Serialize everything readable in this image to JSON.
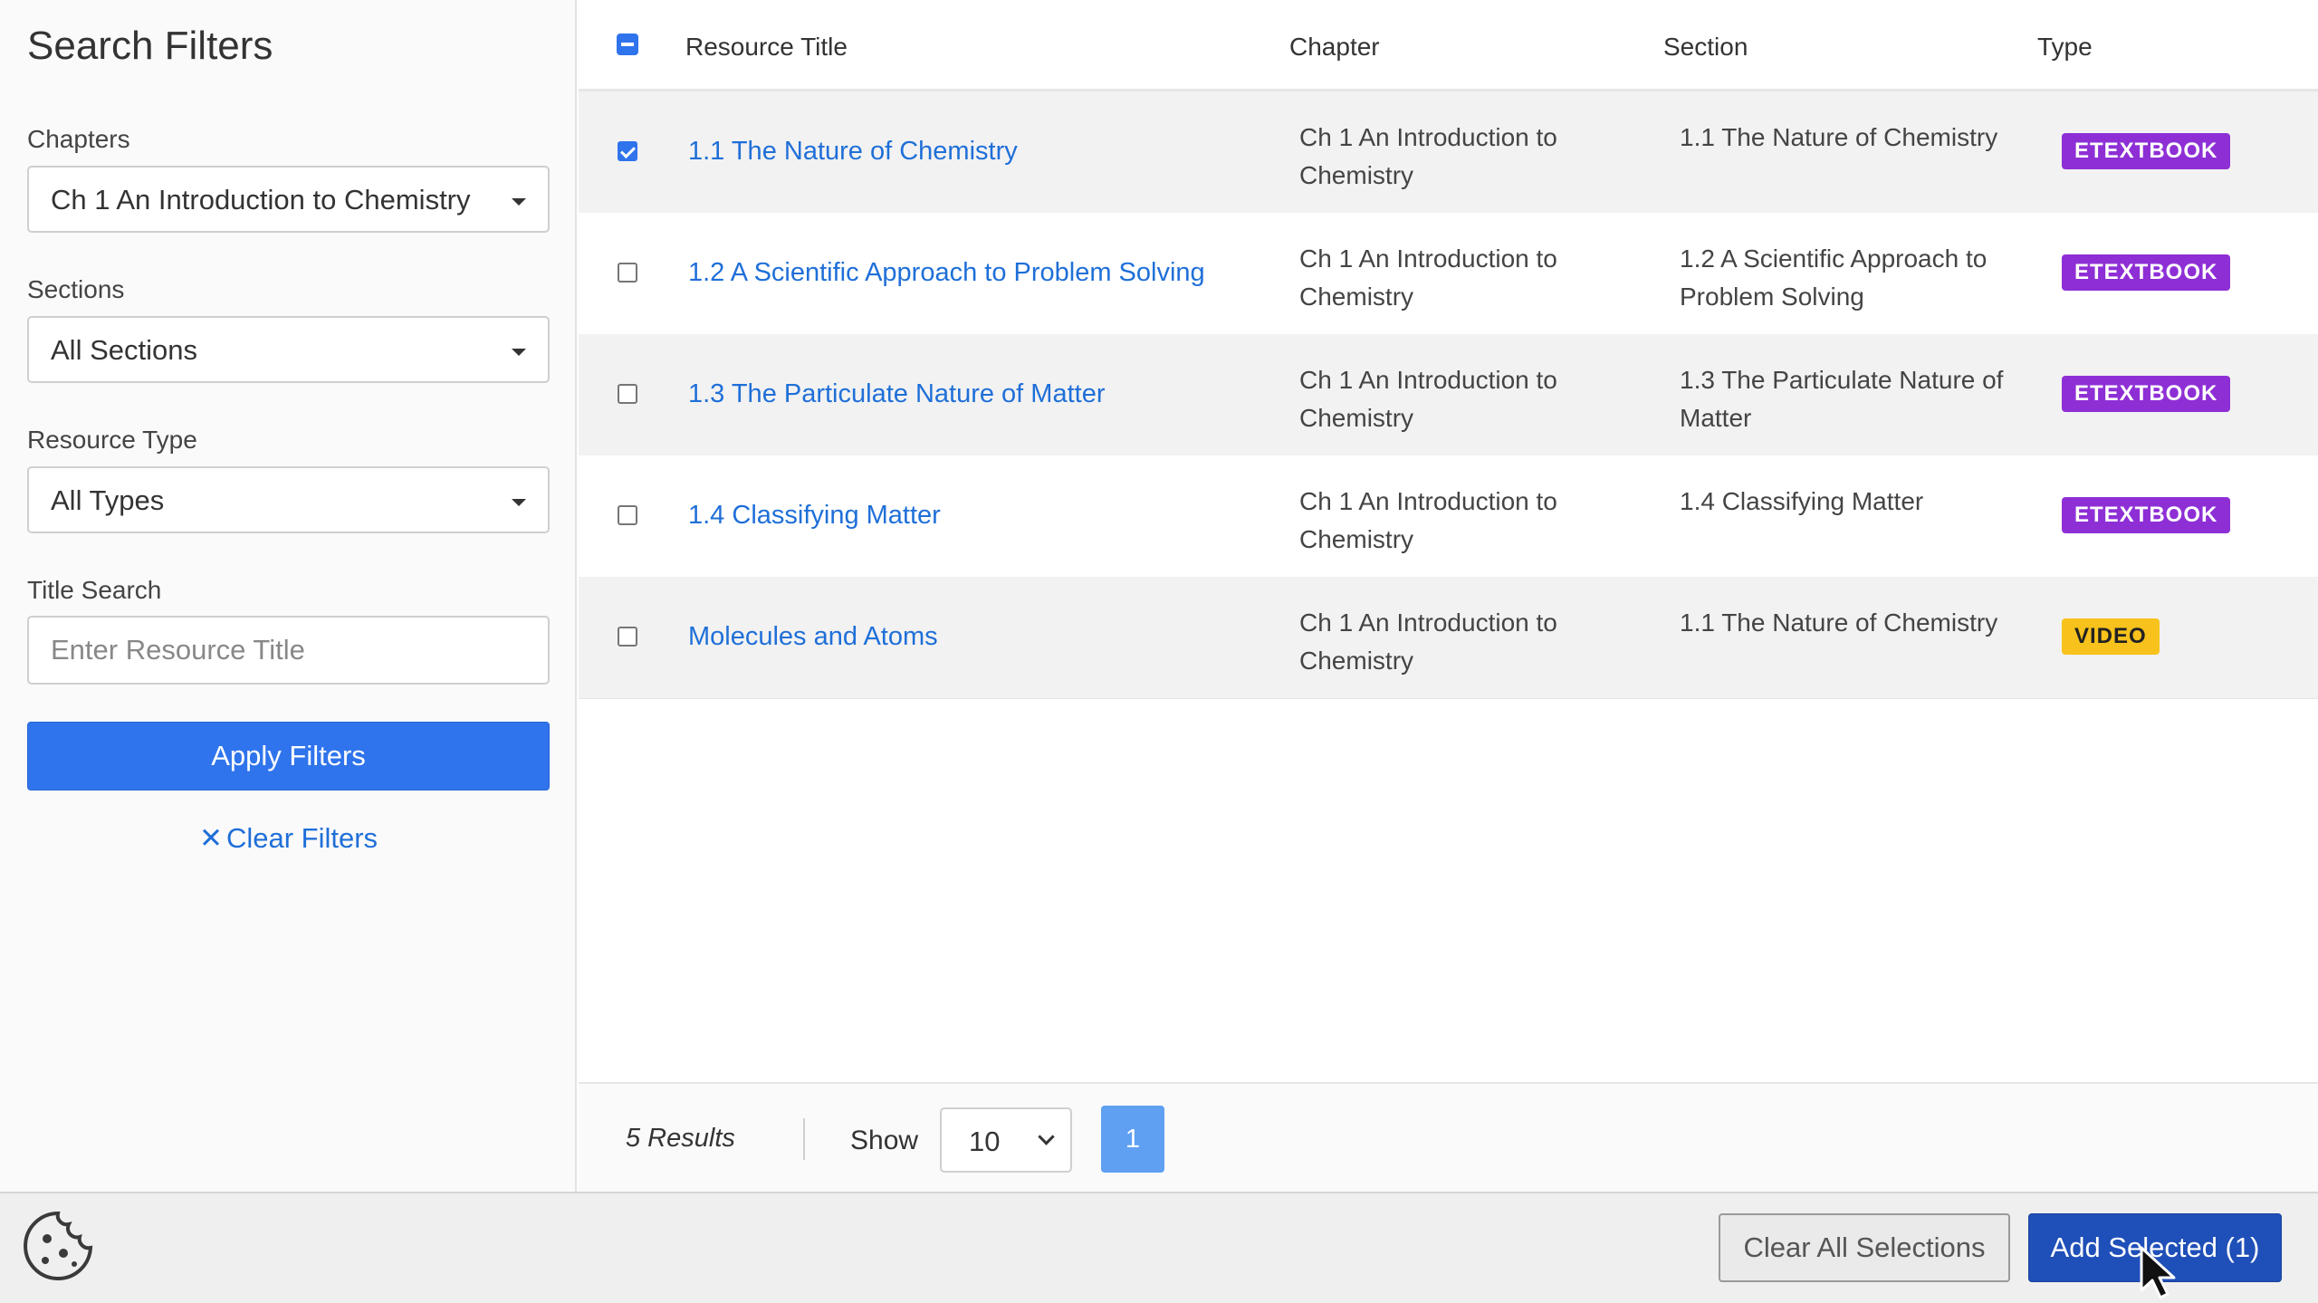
{
  "sidebar": {
    "title": "Search Filters",
    "chapters": {
      "label": "Chapters",
      "value": "Ch 1 An Introduction to Chemistry"
    },
    "sections": {
      "label": "Sections",
      "value": "All Sections"
    },
    "resource_type": {
      "label": "Resource Type",
      "value": "All Types"
    },
    "title_search": {
      "label": "Title Search",
      "placeholder": "Enter Resource Title",
      "value": ""
    },
    "apply_label": "Apply Filters",
    "clear_label": "Clear Filters"
  },
  "table": {
    "headers": {
      "title": "Resource Title",
      "chapter": "Chapter",
      "section": "Section",
      "type": "Type"
    },
    "rows": [
      {
        "title": "1.1 The Nature of Chemistry",
        "chapter": "Ch 1 An Introduction to Chemistry",
        "section": "1.1 The Nature of Chemistry",
        "type": "ETEXTBOOK",
        "checked": true
      },
      {
        "title": "1.2 A Scientific Approach to Problem Solving",
        "chapter": "Ch 1 An Introduction to Chemistry",
        "section": "1.2 A Scientific Approach to Problem Solving",
        "type": "ETEXTBOOK",
        "checked": false
      },
      {
        "title": "1.3 The Particulate Nature of Matter",
        "chapter": "Ch 1 An Introduction to Chemistry",
        "section": "1.3 The Particulate Nature of Matter",
        "type": "ETEXTBOOK",
        "checked": false
      },
      {
        "title": "1.4 Classifying Matter",
        "chapter": "Ch 1 An Introduction to Chemistry",
        "section": "1.4 Classifying Matter",
        "type": "ETEXTBOOK",
        "checked": false
      },
      {
        "title": "Molecules and Atoms",
        "chapter": "Ch 1 An Introduction to Chemistry",
        "section": "1.1 The Nature of Chemistry",
        "type": "VIDEO",
        "checked": false
      }
    ]
  },
  "pagination": {
    "results": "5 Results",
    "show_label": "Show",
    "page_size": "10",
    "current_page": "1"
  },
  "footer": {
    "cookie_icon": "cookie-icon",
    "clear_all_label": "Clear All Selections",
    "add_selected_label": "Add Selected (1)"
  },
  "colors": {
    "primary": "#2f74ec",
    "link": "#1f6fd8",
    "etextbook_badge": "#8e2fd6",
    "video_badge": "#f7c21b",
    "add_selected": "#1f4fb8"
  }
}
